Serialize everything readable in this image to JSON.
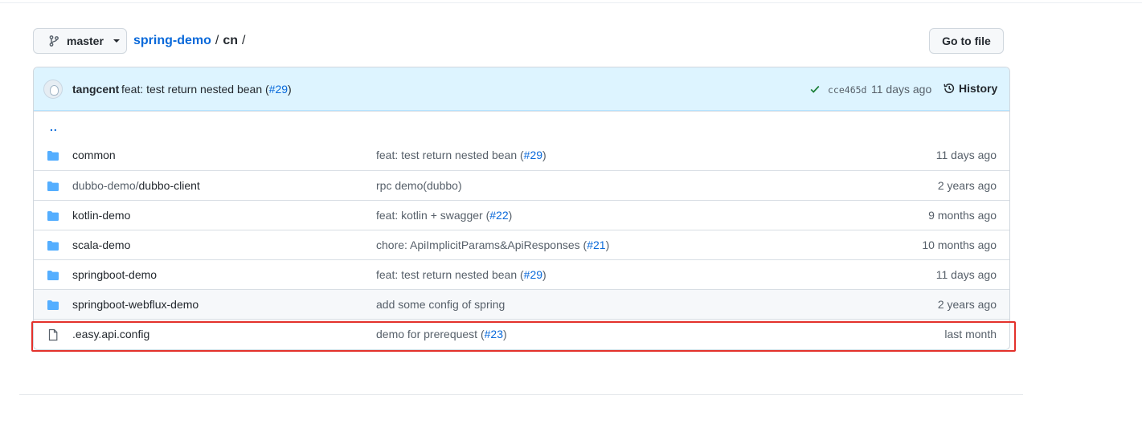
{
  "branch": {
    "name": "master"
  },
  "breadcrumb": {
    "repo": "spring-demo",
    "sep1": "/",
    "current": "cn",
    "sep2": "/"
  },
  "goto_file_label": "Go to file",
  "commit": {
    "author": "tangcent",
    "message_prefix": "feat: test return nested bean (",
    "message_link": "#29",
    "message_suffix": ")",
    "sha": "cce465d",
    "time": "11 days ago",
    "history_label": "History",
    "status_color": "#1a7f37"
  },
  "parent_dir": "..",
  "files": [
    {
      "type": "dir",
      "name_prefix": "",
      "name": "common",
      "msg": "feat: test return nested bean (",
      "msg_link": "#29",
      "msg_suffix": ")",
      "time": "11 days ago"
    },
    {
      "type": "dir",
      "name_prefix": "dubbo-demo/",
      "name": "dubbo-client",
      "msg": "rpc demo(dubbo)",
      "msg_link": "",
      "msg_suffix": "",
      "time": "2 years ago"
    },
    {
      "type": "dir",
      "name_prefix": "",
      "name": "kotlin-demo",
      "msg": "feat: kotlin + swagger (",
      "msg_link": "#22",
      "msg_suffix": ")",
      "time": "9 months ago"
    },
    {
      "type": "dir",
      "name_prefix": "",
      "name": "scala-demo",
      "msg": "chore: ApiImplicitParams&ApiResponses (",
      "msg_link": "#21",
      "msg_suffix": ")",
      "time": "10 months ago"
    },
    {
      "type": "dir",
      "name_prefix": "",
      "name": "springboot-demo",
      "msg": "feat: test return nested bean (",
      "msg_link": "#29",
      "msg_suffix": ")",
      "time": "11 days ago"
    },
    {
      "type": "dir",
      "name_prefix": "",
      "name": "springboot-webflux-demo",
      "msg": "add some config of spring",
      "msg_link": "",
      "msg_suffix": "",
      "time": "2 years ago"
    },
    {
      "type": "file",
      "name_prefix": "",
      "name": ".easy.api.config",
      "msg": "demo for prerequest (",
      "msg_link": "#23",
      "msg_suffix": ")",
      "time": "last month"
    }
  ],
  "colors": {
    "link": "#0969da",
    "folder": "#54aeff",
    "highlight": "#e3312b",
    "commit_bg": "#ddf4ff"
  }
}
